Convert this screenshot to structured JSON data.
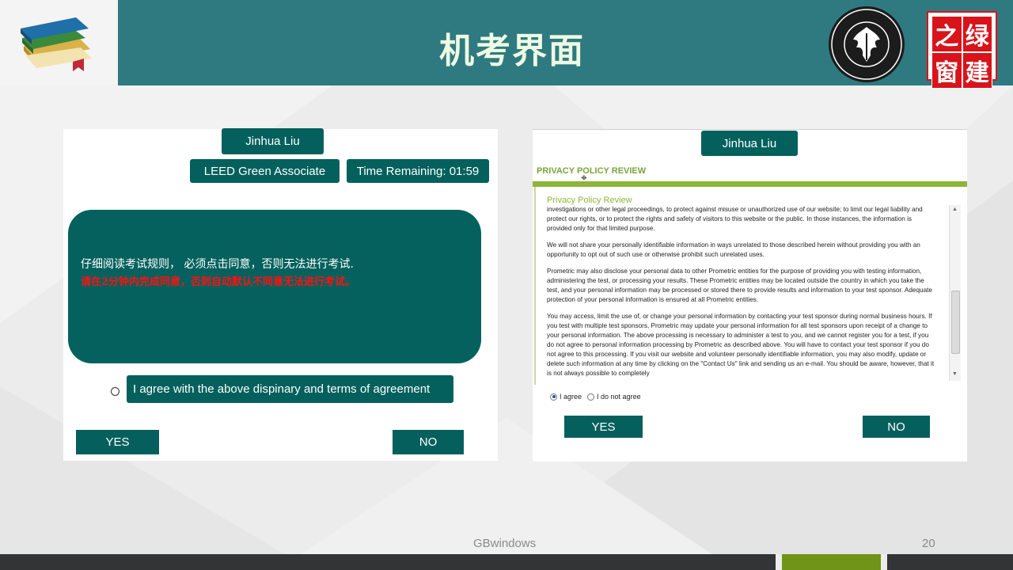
{
  "slide": {
    "title": "机考界面",
    "footer_text": "GBwindows",
    "page_number": "20",
    "logo_text": [
      "之",
      "绿",
      "窗",
      "建"
    ]
  },
  "left_screen": {
    "candidate_name": "Jinhua Liu",
    "exam_name": "LEED Green Associate",
    "time_remaining": "Time Remaining: 01:59",
    "rule_line_1": "仔细阅读考试规则， 必须点击同意，否则无法进行考试.",
    "rule_line_2": "请在2分钟内完成同意，否则自动默认不同意无法进行考试。",
    "agree_label": "I agree with the above dispinary and terms of agreement",
    "yes_label": "YES",
    "no_label": "NO"
  },
  "right_screen": {
    "candidate_name": "Jinhua Liu",
    "section_title": "PRIVACY POLICY REVIEW",
    "subtitle": "Privacy Policy Review",
    "paragraphs": [
      "investigations or other legal proceedings, to protect against misuse or unauthorized use of our website; to limit our legal liability and protect our rights, or to protect the rights and safety of visitors to this website or the public. In those instances, the information is provided only for that limited purpose.",
      "We will not share your personally identifiable information in ways unrelated to those described herein without providing you with an opportunity to opt out of such use or otherwise prohibit such unrelated uses.",
      "Prometric may also disclose your personal data to other Prometric entities for the purpose of providing you with testing information, administering the test, or processing your results. These Prometric entities may be located outside the country in which you take the test, and your personal information may be processed or stored there to provide results and information to your test sponsor. Adequate protection of your personal information is ensured at all Prometric entities.",
      "You may access, limit the use of, or change your personal information by contacting your test sponsor during normal business hours. If you test with multiple test sponsors, Prometric may update your personal information for all test sponsors upon receipt of a change to your personal information. The above processing is necessary to administer a test to you, and we cannot register you for a test, if you do not agree to personal information processing by Prometric as described above. You will have to contact your test sponsor if you do not agree to this processing. If you visit our website and volunteer personally identifiable information, you may also modify, update or delete such information at any time by clicking on the \"Contact Us\" link and sending us an e-mail. You should be aware, however, that it is not always possible to completely"
    ],
    "agree_option": "I agree",
    "disagree_option": "I do not agree",
    "yes_label": "YES",
    "no_label": "NO"
  },
  "colors": {
    "header": "#2f7a80",
    "teal_button": "#03605d",
    "policy_green": "#8db53a",
    "footer_accent": "#6f9418"
  }
}
